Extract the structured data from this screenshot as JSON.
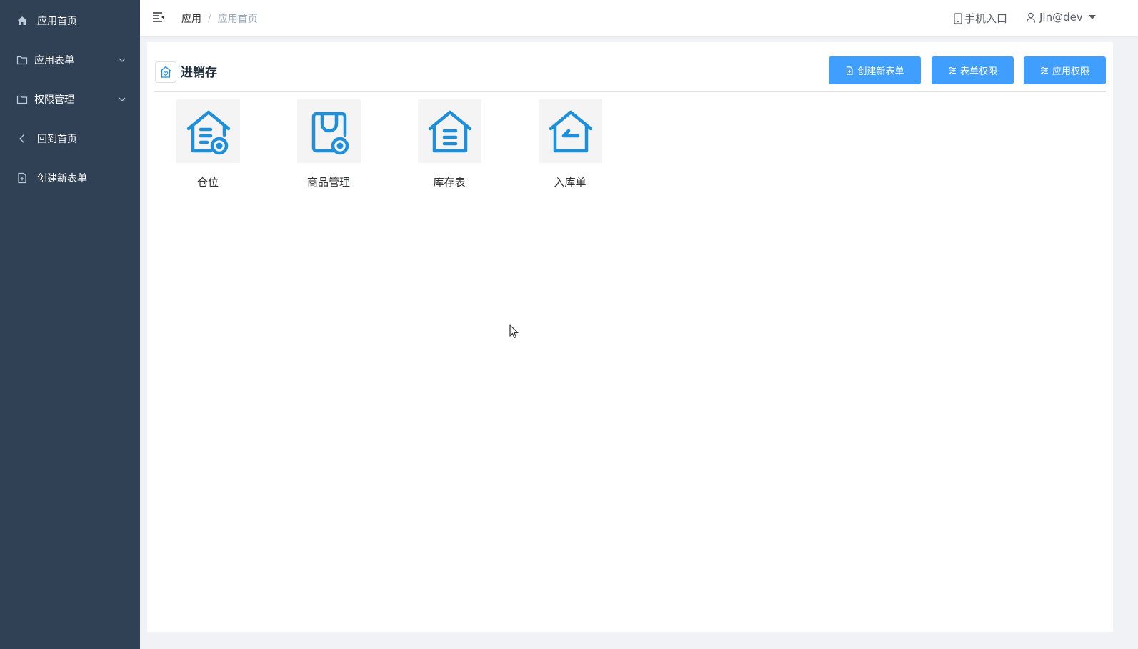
{
  "sidebar": {
    "items": [
      {
        "label": "应用首页",
        "icon": "home-icon"
      },
      {
        "label": "应用表单",
        "icon": "folder-icon"
      },
      {
        "label": "权限管理",
        "icon": "folder-icon"
      },
      {
        "label": "回到首页",
        "icon": "chevron-left-icon"
      },
      {
        "label": "创建新表单",
        "icon": "document-add-icon"
      }
    ]
  },
  "header": {
    "breadcrumb": [
      "应用",
      "应用首页"
    ],
    "breadcrumb_separator": "/",
    "mobile_entry": "手机入口",
    "user": "Jin@dev"
  },
  "main": {
    "app_title": "进销存",
    "buttons": {
      "create_form": "创建新表单",
      "form_permission": "表单权限",
      "app_permission": "应用权限"
    },
    "apps": [
      {
        "name": "仓位",
        "icon": "house-settings-icon"
      },
      {
        "name": "商品管理",
        "icon": "bag-settings-icon"
      },
      {
        "name": "库存表",
        "icon": "house-list-icon"
      },
      {
        "name": "入库单",
        "icon": "house-return-icon"
      }
    ]
  },
  "colors": {
    "sidebar_bg": "#304156",
    "primary": "#409eff",
    "icon_blue": "#1e8fd8"
  }
}
